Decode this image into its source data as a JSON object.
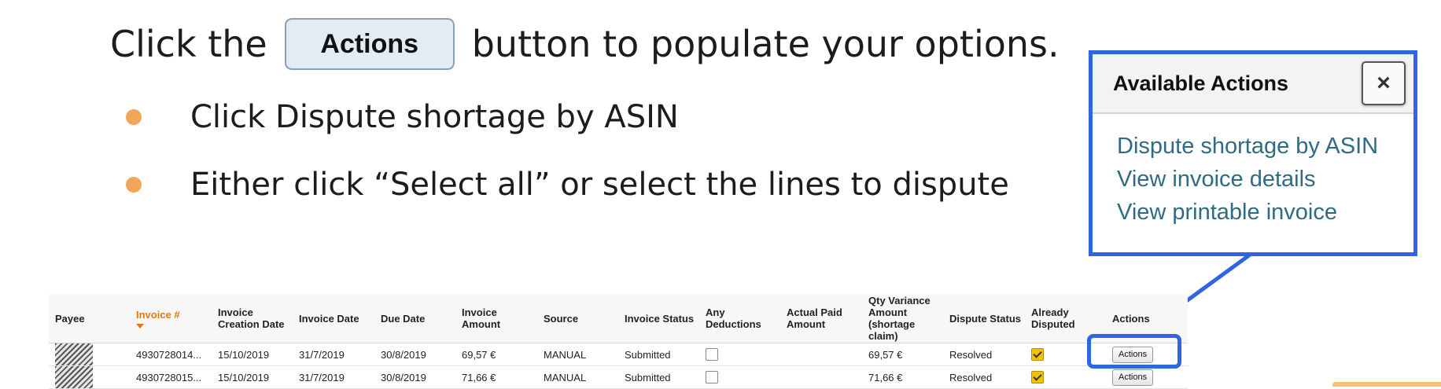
{
  "instruction": {
    "prefix": "Click the",
    "button_label": "Actions",
    "suffix": "button to populate your options."
  },
  "bullets": [
    "Click Dispute shortage by ASIN",
    "Either click “Select all” or select the lines to dispute"
  ],
  "popover": {
    "title": "Available Actions",
    "close_symbol": "×",
    "items": [
      "Dispute shortage by ASIN",
      "View invoice details",
      "View printable invoice"
    ]
  },
  "table": {
    "headers": [
      "Payee",
      "Invoice #",
      "Invoice Creation Date",
      "Invoice Date",
      "Due Date",
      "Invoice Amount",
      "Source",
      "Invoice Status",
      "Any Deductions",
      "Actual Paid Amount",
      "Qty Variance Amount (shortage claim)",
      "Dispute Status",
      "Already Disputed",
      "Actions"
    ],
    "rows": [
      {
        "invoice": "4930728014...",
        "creation": "15/10/2019",
        "invoice_date": "31/7/2019",
        "due": "30/8/2019",
        "amount": "69,57 €",
        "source": "MANUAL",
        "status": "Submitted",
        "any_deductions": false,
        "paid": "",
        "qty_variance": "69,57 €",
        "dispute_status": "Resolved",
        "already_disputed": true,
        "action": "Actions"
      },
      {
        "invoice": "4930728015...",
        "creation": "15/10/2019",
        "invoice_date": "31/7/2019",
        "due": "30/8/2019",
        "amount": "71,66 €",
        "source": "MANUAL",
        "status": "Submitted",
        "any_deductions": false,
        "paid": "",
        "qty_variance": "71,66 €",
        "dispute_status": "Resolved",
        "already_disputed": true,
        "action": "Actions"
      }
    ]
  },
  "colors": {
    "highlight": "#2e66e0",
    "bullet": "#f2a65a",
    "link": "#2f6b83",
    "sorted_header": "#e47911"
  }
}
